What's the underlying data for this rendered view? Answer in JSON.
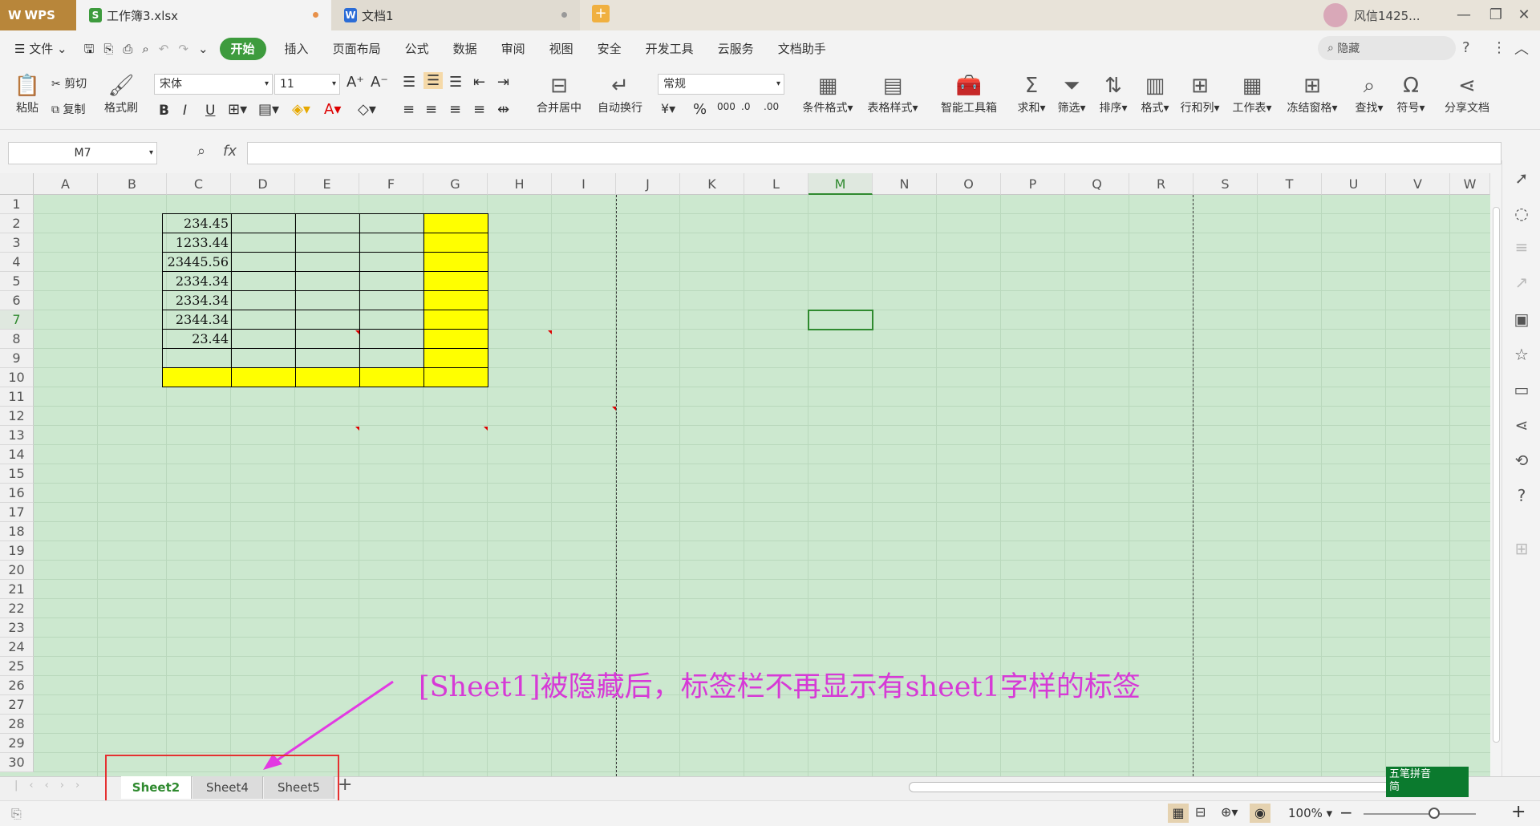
{
  "titlebar": {
    "app": "WPS",
    "tabs": [
      {
        "label": "工作簿3.xlsx",
        "icon": "S",
        "color": "#3d9b3d"
      },
      {
        "label": "文档1",
        "icon": "W",
        "color": "#2b6cd6"
      }
    ],
    "user": "风信1425..."
  },
  "menubar": {
    "file": "文件",
    "items": [
      "开始",
      "插入",
      "页面布局",
      "公式",
      "数据",
      "审阅",
      "视图",
      "安全",
      "开发工具",
      "云服务",
      "文档助手"
    ],
    "active": "开始",
    "search_label": "隐藏"
  },
  "ribbon": {
    "paste": "粘贴",
    "cut": "剪切",
    "copy": "复制",
    "format_painter": "格式刷",
    "font_name": "宋体",
    "font_size": "11",
    "merge_center": "合并居中",
    "wrap_text": "自动换行",
    "number_format": "常规",
    "conditional_format": "条件格式",
    "table_style": "表格样式",
    "smart_toolbox": "智能工具箱",
    "sum": "求和",
    "filter": "筛选",
    "sort": "排序",
    "format": "格式",
    "rows_cols": "行和列",
    "worksheet": "工作表",
    "freeze": "冻结窗格",
    "find": "查找",
    "symbol": "符号",
    "share": "分享文档"
  },
  "formula_bar": {
    "name_box": "M7",
    "fx": "fx",
    "value": ""
  },
  "grid": {
    "columns": [
      "A",
      "B",
      "C",
      "D",
      "E",
      "F",
      "G",
      "H",
      "I",
      "J",
      "K",
      "L",
      "M",
      "N",
      "O",
      "P",
      "Q",
      "R",
      "S",
      "T",
      "U",
      "V",
      "W"
    ],
    "selected_column": "M",
    "rows": [
      "1",
      "2",
      "3",
      "4",
      "5",
      "6",
      "7",
      "8",
      "9",
      "10",
      "11",
      "12",
      "13",
      "14",
      "15",
      "16",
      "17",
      "18",
      "19",
      "20",
      "21",
      "22",
      "23",
      "24",
      "25",
      "26",
      "27",
      "28",
      "29",
      "30"
    ],
    "selected_row": "7",
    "b_values": [
      "234.45",
      "1233.44",
      "23445.56",
      "2334.34",
      "2334.34",
      "2344.34",
      "23.44"
    ]
  },
  "annotation": "[Sheet1]被隐藏后，标签栏不再显示有sheet1字样的标签",
  "sheets": [
    "Sheet2",
    "Sheet4",
    "Sheet5"
  ],
  "active_sheet": "Sheet2",
  "status": {
    "zoom": "100%"
  },
  "ime": {
    "line1": "五笔拼音",
    "line2": "简"
  }
}
